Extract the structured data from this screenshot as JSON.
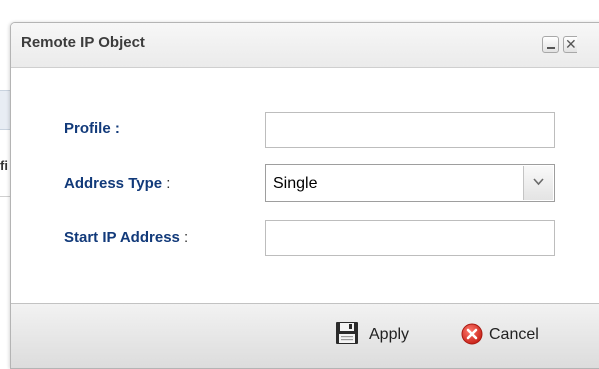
{
  "dialog": {
    "title": "Remote IP Object"
  },
  "form": {
    "profile": {
      "label": "Profile",
      "colon": " :",
      "value": "",
      "placeholder": ""
    },
    "address_type": {
      "label": "Address Type",
      "colon": " :",
      "selected": "Single"
    },
    "start_ip": {
      "label": "Start IP Address",
      "colon": " :",
      "value": "",
      "placeholder": ""
    }
  },
  "footer": {
    "apply_label": "Apply",
    "cancel_label": "Cancel"
  },
  "colors": {
    "label_text": "#123a7a",
    "cancel_icon": "#d9342b"
  },
  "icons": {
    "apply": "floppy-disk-icon",
    "cancel": "red-x-circle-icon"
  }
}
